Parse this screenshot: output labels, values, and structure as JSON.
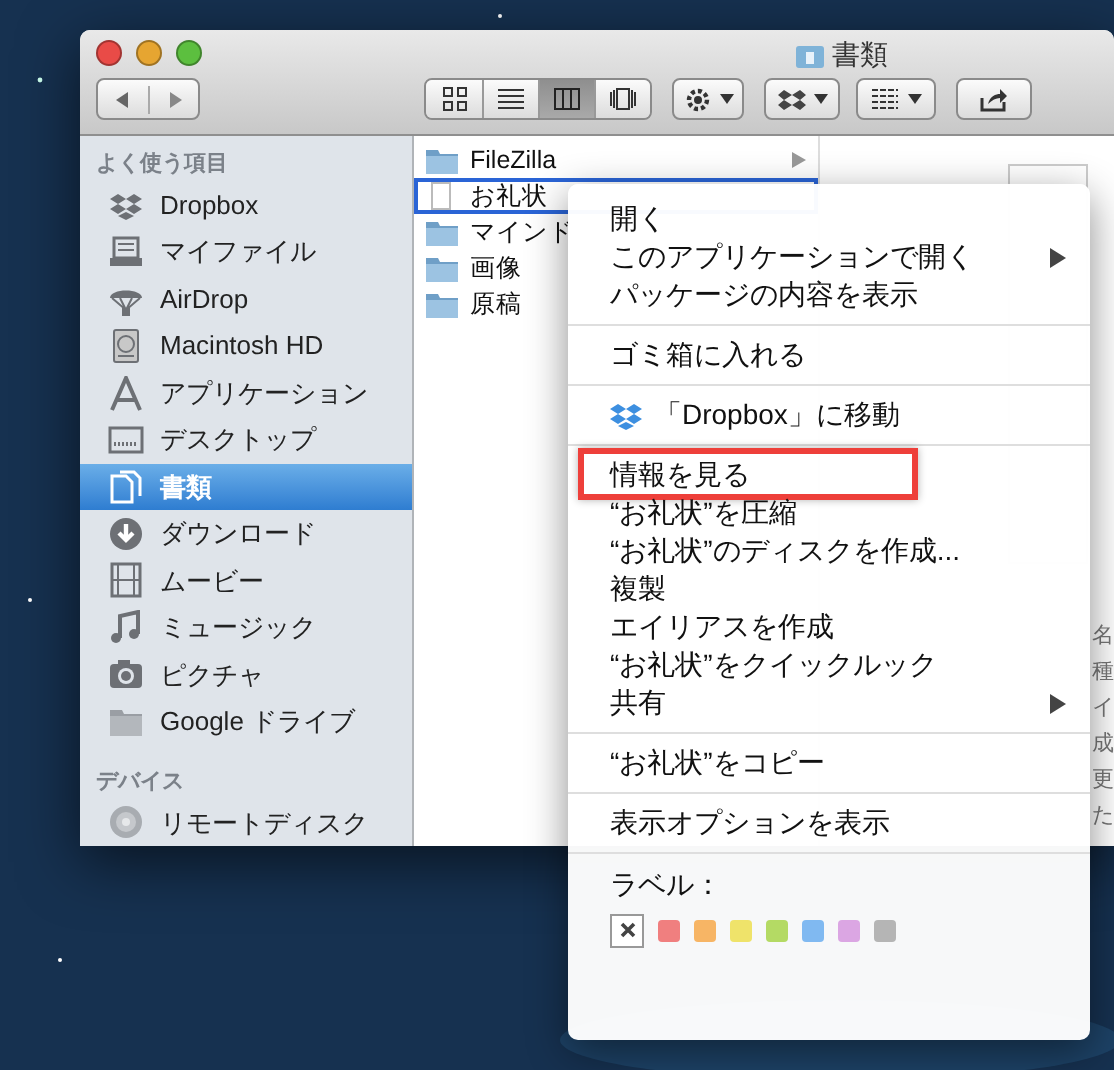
{
  "window": {
    "title": "書類"
  },
  "toolbar": {
    "views": [
      {
        "kind": "icons",
        "selected": false
      },
      {
        "kind": "list",
        "selected": false
      },
      {
        "kind": "columns",
        "selected": true
      },
      {
        "kind": "coverflow",
        "selected": false
      }
    ]
  },
  "sidebar": {
    "sections": [
      {
        "heading": "よく使う項目",
        "items": [
          {
            "label": "Dropbox",
            "kind": "dropbox",
            "selected": false
          },
          {
            "label": "マイファイル",
            "kind": "files",
            "selected": false
          },
          {
            "label": "AirDrop",
            "kind": "airdrop",
            "selected": false
          },
          {
            "label": "Macintosh HD",
            "kind": "disk",
            "selected": false
          },
          {
            "label": "アプリケーション",
            "kind": "apps",
            "selected": false
          },
          {
            "label": "デスクトップ",
            "kind": "desktop",
            "selected": false
          },
          {
            "label": "書類",
            "kind": "document",
            "selected": true
          },
          {
            "label": "ダウンロード",
            "kind": "download",
            "selected": false
          },
          {
            "label": "ムービー",
            "kind": "movie",
            "selected": false
          },
          {
            "label": "ミュージック",
            "kind": "music",
            "selected": false
          },
          {
            "label": "ピクチャ",
            "kind": "camera",
            "selected": false
          },
          {
            "label": "Google ドライブ",
            "kind": "folder",
            "selected": false
          }
        ]
      },
      {
        "heading": "デバイス",
        "items": [
          {
            "label": "リモートディスク",
            "kind": "remote",
            "selected": false
          }
        ]
      }
    ]
  },
  "column": {
    "items": [
      {
        "label": "FileZilla",
        "kind": "folder",
        "selected": false,
        "has_children": true
      },
      {
        "label": "お礼状",
        "kind": "file",
        "selected": true,
        "has_children": false
      },
      {
        "label": "マインド",
        "kind": "folder",
        "selected": false,
        "has_children": false
      },
      {
        "label": "画像",
        "kind": "folder",
        "selected": false,
        "has_children": false
      },
      {
        "label": "原稿",
        "kind": "folder",
        "selected": false,
        "has_children": false
      }
    ]
  },
  "preview_fragments": [
    "名",
    "種",
    "イ",
    "成",
    "更",
    "た"
  ],
  "context_menu": {
    "groups": [
      [
        {
          "label": "開く",
          "submenu": false,
          "annotated": false
        },
        {
          "label": "このアプリケーションで開く",
          "submenu": true,
          "annotated": false
        },
        {
          "label": "パッケージの内容を表示",
          "submenu": false,
          "annotated": false
        }
      ],
      [
        {
          "label": "ゴミ箱に入れる",
          "submenu": false,
          "annotated": false
        }
      ],
      [
        {
          "label": "「Dropbox」に移動",
          "submenu": false,
          "annotated": false,
          "kind": "dropbox"
        }
      ],
      [
        {
          "label": "情報を見る",
          "submenu": false,
          "annotated": true
        },
        {
          "label": "“お礼状”を圧縮",
          "submenu": false,
          "annotated": false
        },
        {
          "label": "“お礼状”のディスクを作成...",
          "submenu": false,
          "annotated": false
        },
        {
          "label": "複製",
          "submenu": false,
          "annotated": false
        },
        {
          "label": "エイリアスを作成",
          "submenu": false,
          "annotated": false
        },
        {
          "label": "“お礼状”をクイックルック",
          "submenu": false,
          "annotated": false
        },
        {
          "label": "共有",
          "submenu": true,
          "annotated": false
        }
      ],
      [
        {
          "label": "“お礼状”をコピー",
          "submenu": false,
          "annotated": false
        }
      ],
      [
        {
          "label": "表示オプションを表示",
          "submenu": false,
          "annotated": false
        }
      ]
    ],
    "label_title": "ラベル：",
    "labels": [
      {
        "kind": "none"
      },
      {
        "kind": "color",
        "color": "#f07f7f"
      },
      {
        "kind": "color",
        "color": "#f7b565"
      },
      {
        "kind": "color",
        "color": "#efe36a"
      },
      {
        "kind": "color",
        "color": "#b4da64"
      },
      {
        "kind": "color",
        "color": "#80b9f1"
      },
      {
        "kind": "color",
        "color": "#dba6e3"
      },
      {
        "kind": "color",
        "color": "#b5b5b5"
      }
    ]
  }
}
